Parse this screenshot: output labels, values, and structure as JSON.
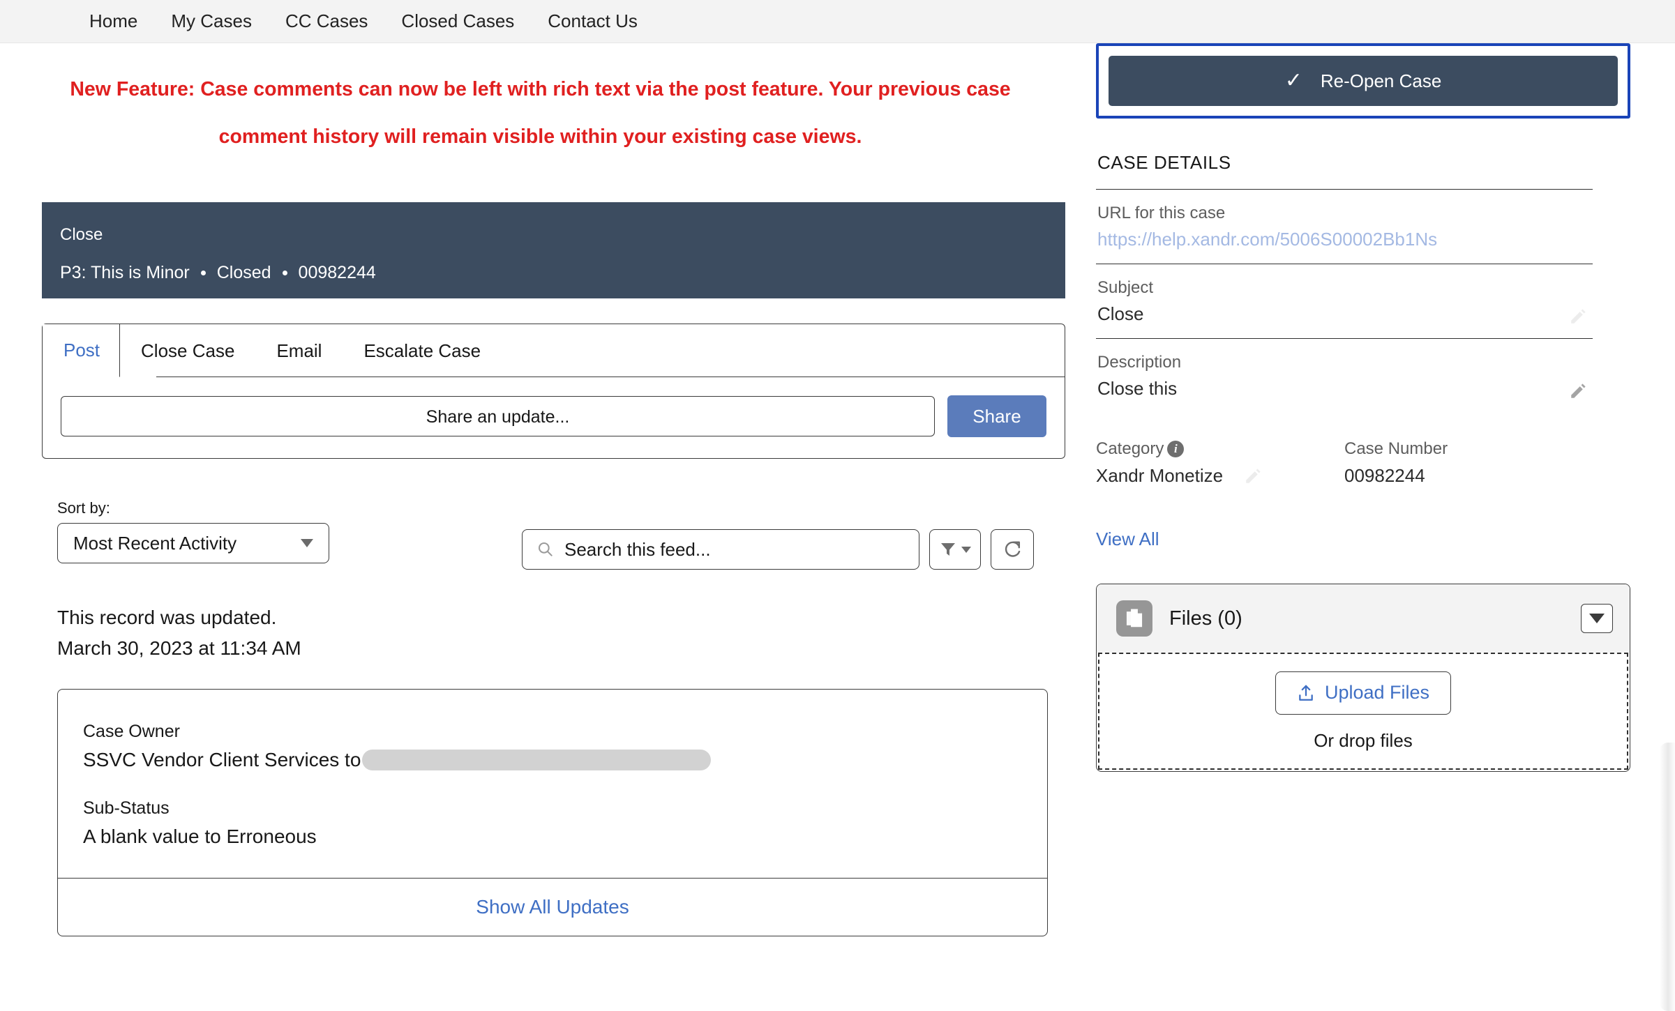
{
  "nav": {
    "items": [
      {
        "label": "Home"
      },
      {
        "label": "My Cases"
      },
      {
        "label": "CC Cases"
      },
      {
        "label": "Closed Cases"
      },
      {
        "label": "Contact Us"
      }
    ]
  },
  "banner": {
    "line1": "New Feature: Case comments can now be left with rich text via the post feature. Your previous case",
    "line2": "comment history will remain visible within your existing case views.",
    "color": "#e02020"
  },
  "case_header": {
    "title": "Close",
    "priority": "P3: This is Minor",
    "status": "Closed",
    "number": "00982244",
    "background": "#3c4c60"
  },
  "publisher": {
    "tabs": [
      {
        "label": "Post",
        "active": true
      },
      {
        "label": "Close Case",
        "active": false
      },
      {
        "label": "Email",
        "active": false
      },
      {
        "label": "Escalate Case",
        "active": false
      }
    ],
    "composer_placeholder": "Share an update...",
    "share_label": "Share",
    "share_color": "#5b7cbb"
  },
  "feed_controls": {
    "sort_label": "Sort by:",
    "sort_value": "Most Recent Activity",
    "search_placeholder": "Search this feed...",
    "search_icon": "search-icon",
    "filter_icon": "filter-icon",
    "refresh_icon": "refresh-icon"
  },
  "feed": {
    "item": {
      "headline": "This record was updated.",
      "timestamp": "March 30, 2023 at 11:34 AM",
      "fields": [
        {
          "label": "Case Owner",
          "value": "SSVC Vendor Client Services to",
          "redacted": true
        },
        {
          "label": "Sub-Status",
          "value": "A blank value to Erroneous",
          "redacted": false
        }
      ],
      "show_all_label": "Show All Updates"
    }
  },
  "right": {
    "reopen_label": "Re-Open Case",
    "reopen_icon": "check-icon",
    "reopen_bg": "#3c4c60",
    "focus_ring_color": "#1a44b8",
    "details_title": "CASE DETAILS",
    "rows": [
      {
        "label": "URL for this case",
        "value": "https://help.xandr.com/5006S00002Bb1Ns",
        "is_link": true,
        "editable": false
      },
      {
        "label": "Subject",
        "value": "Close",
        "is_link": false,
        "editable": true
      },
      {
        "label": "Description",
        "value": "Close this",
        "is_link": false,
        "editable": true
      }
    ],
    "two_col": [
      {
        "label": "Category",
        "value": "Xandr Monetize",
        "has_info": true,
        "editable": true
      },
      {
        "label": "Case Number",
        "value": "00982244",
        "has_info": false,
        "editable": false
      }
    ],
    "view_all_label": "View All",
    "files": {
      "title": "Files (0)",
      "icon": "files-icon",
      "toggle_icon": "chevron-down-icon",
      "upload_label": "Upload Files",
      "upload_icon": "upload-icon",
      "drop_label": "Or drop files"
    }
  }
}
